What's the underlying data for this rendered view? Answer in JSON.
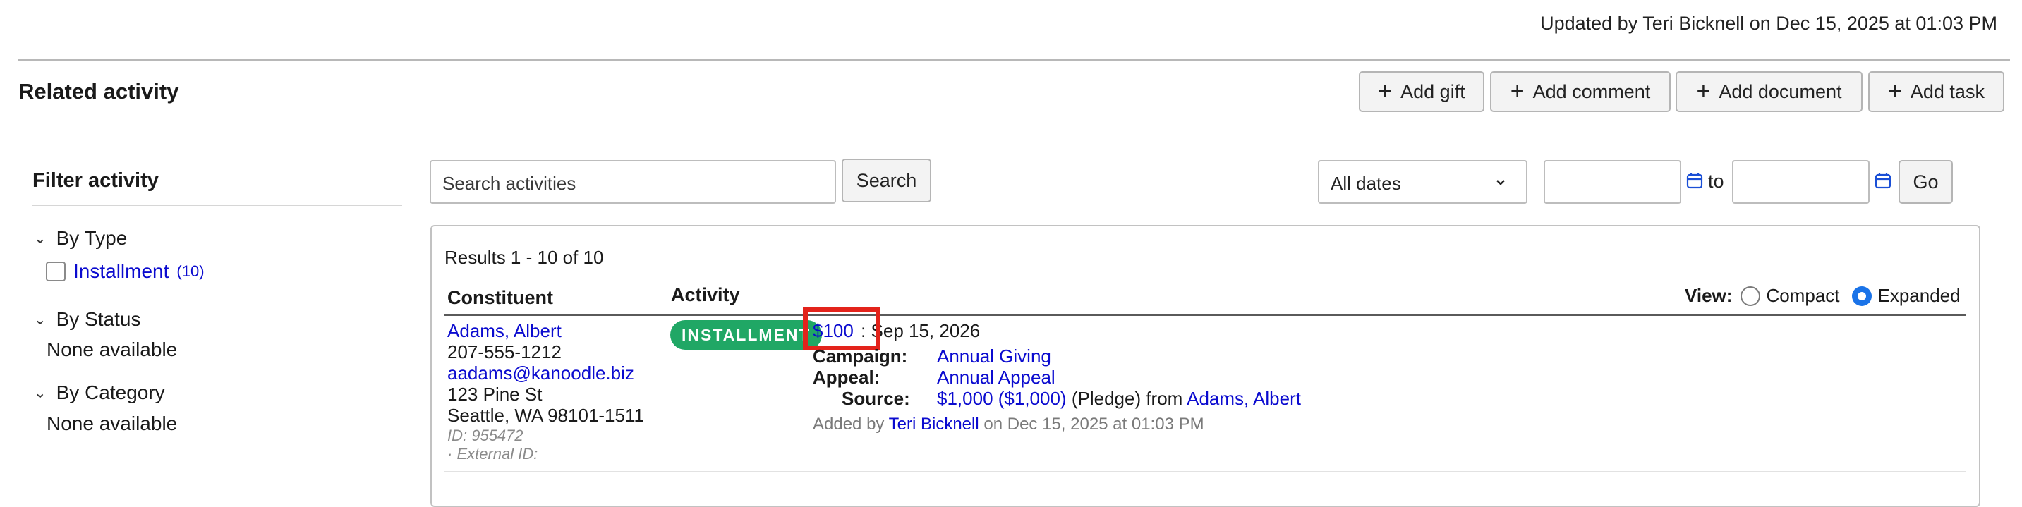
{
  "header": {
    "updated_text": "Updated by Teri Bicknell on Dec 15, 2025 at 01:03 PM",
    "section_title": "Related activity",
    "buttons": {
      "add_gift": "Add gift",
      "add_comment": "Add comment",
      "add_document": "Add document",
      "add_task": "Add task"
    }
  },
  "filters": {
    "title": "Filter activity",
    "by_type": {
      "label": "By Type",
      "item_label": "Installment",
      "item_count": "(10)"
    },
    "by_status": {
      "label": "By Status",
      "empty": "None available"
    },
    "by_category": {
      "label": "By Category",
      "empty": "None available"
    }
  },
  "search": {
    "placeholder": "Search activities",
    "button": "Search",
    "dates_select": "All dates",
    "to_label": "to",
    "go_button": "Go"
  },
  "results": {
    "summary": "Results 1 - 10 of 10",
    "columns": {
      "constituent": "Constituent",
      "activity": "Activity"
    },
    "view": {
      "label": "View:",
      "compact": "Compact",
      "expanded": "Expanded",
      "selected": "Expanded"
    },
    "rows": [
      {
        "constituent_name": "Adams, Albert",
        "phone": "207-555-1212",
        "email": "aadams@kanoodle.biz",
        "address1": "123 Pine St",
        "address2": "Seattle, WA 98101-1511",
        "id_text": "ID: 955472",
        "external_id_text": "· External ID:",
        "badge": "INSTALLMENT",
        "amount": "$100",
        "date_text": ": Sep 15, 2026",
        "campaign_label": "Campaign:",
        "campaign_value": "Annual Giving",
        "appeal_label": "Appeal:",
        "appeal_value": "Annual Appeal",
        "source_label": "Source:",
        "source_amount": "$1,000 ($1,000)",
        "source_middle": "(Pledge) from",
        "source_constituent": "Adams, Albert",
        "added_prefix": "Added by",
        "added_by": "Teri Bicknell",
        "added_suffix": "on Dec 15, 2025 at 01:03 PM"
      }
    ]
  },
  "colors": {
    "badge_green": "#20a765",
    "link_blue": "#0b0bcf",
    "highlight_red": "#e3231b",
    "radio_blue": "#1a73e8"
  }
}
